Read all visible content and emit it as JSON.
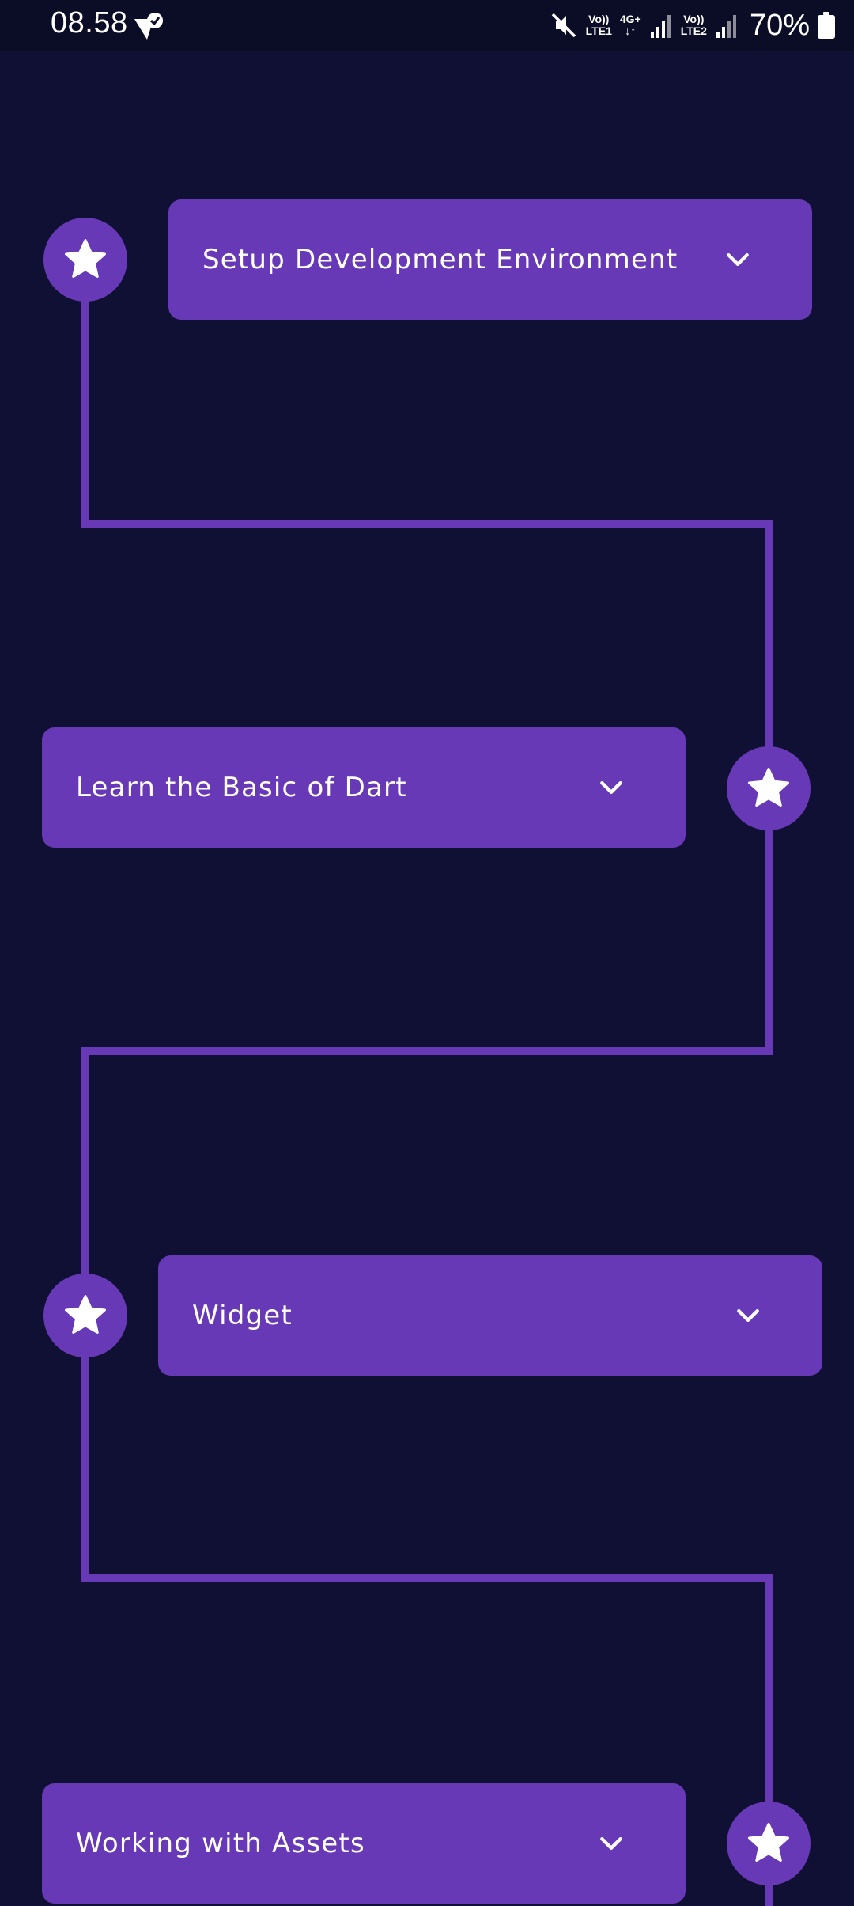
{
  "status_bar": {
    "time": "08.58",
    "net1_top": "Vo))",
    "net1_bottom": "LTE1",
    "net_type_top": "4G+",
    "net_type_bottom": "↓↑",
    "net2_top": "Vo))",
    "net2_bottom": "LTE2",
    "battery": "70%"
  },
  "roadmap": {
    "steps": [
      {
        "title": "Setup Development Environment"
      },
      {
        "title": "Learn the Basic of Dart"
      },
      {
        "title": "Widget"
      },
      {
        "title": "Working with Assets"
      }
    ]
  },
  "colors": {
    "background": "#0f1034",
    "accent": "#6839b6",
    "text": "#ffffff"
  }
}
